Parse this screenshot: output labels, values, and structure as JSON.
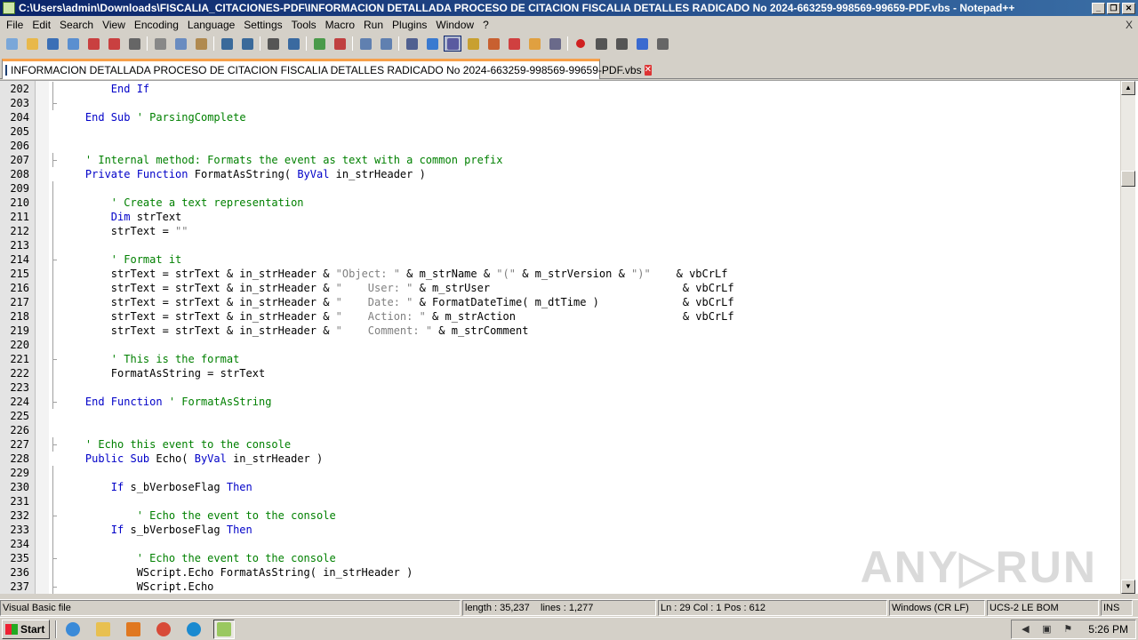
{
  "window": {
    "title": "C:\\Users\\admin\\Downloads\\FISCALIA_CITACIONES-PDF\\INFORMACION DETALLADA PROCESO DE CITACION FISCALIA DETALLES RADICADO No 2024-663259-998569-99659-PDF.vbs - Notepad++",
    "close_label": "X"
  },
  "menu": [
    "File",
    "Edit",
    "Search",
    "View",
    "Encoding",
    "Language",
    "Settings",
    "Tools",
    "Macro",
    "Run",
    "Plugins",
    "Window",
    "?"
  ],
  "toolbar_icons": [
    "new-file-icon",
    "open-file-icon",
    "save-icon",
    "save-all-icon",
    "close-icon",
    "close-all-icon",
    "print-icon",
    "sep",
    "cut-icon",
    "copy-icon",
    "paste-icon",
    "sep",
    "undo-icon",
    "redo-icon",
    "sep",
    "find-icon",
    "replace-icon",
    "sep",
    "zoom-in-icon",
    "zoom-out-icon",
    "sep",
    "sync-vertical-icon",
    "sync-horizontal-icon",
    "sep",
    "word-wrap-icon",
    "show-all-chars-icon",
    "indent-guide-icon",
    "udl-icon",
    "doc-map-icon",
    "function-list-icon",
    "folder-workspace-icon",
    "monitoring-icon",
    "sep",
    "record-macro-icon",
    "stop-macro-icon",
    "play-macro-icon",
    "run-macro-multiple-icon",
    "save-macro-icon"
  ],
  "tab": {
    "label": "INFORMACION DETALLADA PROCESO DE CITACION FISCALIA DETALLES RADICADO No 2024-663259-998569-99659-PDF.vbs",
    "close_glyph": "✕"
  },
  "code_lines": [
    {
      "n": "202",
      "fold": "line",
      "parts": [
        [
          "",
          "        "
        ],
        [
          "kw",
          "End If"
        ]
      ]
    },
    {
      "n": "203",
      "fold": "tick",
      "parts": []
    },
    {
      "n": "204",
      "fold": "none",
      "parts": [
        [
          "",
          "    "
        ],
        [
          "kw",
          "End Sub"
        ],
        [
          "",
          " "
        ],
        [
          "cm",
          "' ParsingComplete"
        ]
      ]
    },
    {
      "n": "205",
      "fold": "none",
      "parts": []
    },
    {
      "n": "206",
      "fold": "none",
      "parts": []
    },
    {
      "n": "207",
      "fold": "tick",
      "parts": [
        [
          "",
          "    "
        ],
        [
          "cm",
          "' Internal method: Formats the event as text with a common prefix"
        ]
      ]
    },
    {
      "n": "208",
      "fold": "none",
      "parts": [
        [
          "",
          "    "
        ],
        [
          "kw",
          "Private Function"
        ],
        [
          "",
          " FormatAsString( "
        ],
        [
          "kw",
          "ByVal"
        ],
        [
          "",
          " in_strHeader )"
        ]
      ]
    },
    {
      "n": "209",
      "fold": "line",
      "parts": []
    },
    {
      "n": "210",
      "fold": "line",
      "parts": [
        [
          "",
          "        "
        ],
        [
          "cm",
          "' Create a text representation"
        ]
      ]
    },
    {
      "n": "211",
      "fold": "line",
      "parts": [
        [
          "",
          "        "
        ],
        [
          "kw",
          "Dim"
        ],
        [
          "",
          " strText"
        ]
      ]
    },
    {
      "n": "212",
      "fold": "line",
      "parts": [
        [
          "",
          "        strText = "
        ],
        [
          "st",
          "\"\""
        ]
      ]
    },
    {
      "n": "213",
      "fold": "line",
      "parts": []
    },
    {
      "n": "214",
      "fold": "tick",
      "parts": [
        [
          "",
          "        "
        ],
        [
          "cm",
          "' Format it"
        ]
      ]
    },
    {
      "n": "215",
      "fold": "line",
      "parts": [
        [
          "",
          "        strText = strText & in_strHeader & "
        ],
        [
          "st",
          "\"Object: \""
        ],
        [
          "",
          " & m_strName & "
        ],
        [
          "st",
          "\"(\""
        ],
        [
          "",
          " & m_strVersion & "
        ],
        [
          "st",
          "\")\""
        ],
        [
          "",
          "    & vbCrLf"
        ]
      ]
    },
    {
      "n": "216",
      "fold": "line",
      "parts": [
        [
          "",
          "        strText = strText & in_strHeader & "
        ],
        [
          "st",
          "\"    User: \""
        ],
        [
          "",
          " & m_strUser                              & vbCrLf"
        ]
      ]
    },
    {
      "n": "217",
      "fold": "line",
      "parts": [
        [
          "",
          "        strText = strText & in_strHeader & "
        ],
        [
          "st",
          "\"    Date: \""
        ],
        [
          "",
          " & FormatDateTime( m_dtTime )             & vbCrLf"
        ]
      ]
    },
    {
      "n": "218",
      "fold": "line",
      "parts": [
        [
          "",
          "        strText = strText & in_strHeader & "
        ],
        [
          "st",
          "\"    Action: \""
        ],
        [
          "",
          " & m_strAction                          & vbCrLf"
        ]
      ]
    },
    {
      "n": "219",
      "fold": "line",
      "parts": [
        [
          "",
          "        strText = strText & in_strHeader & "
        ],
        [
          "st",
          "\"    Comment: \""
        ],
        [
          "",
          " & m_strComment"
        ]
      ]
    },
    {
      "n": "220",
      "fold": "line",
      "parts": []
    },
    {
      "n": "221",
      "fold": "tick",
      "parts": [
        [
          "",
          "        "
        ],
        [
          "cm",
          "' This is the format"
        ]
      ]
    },
    {
      "n": "222",
      "fold": "line",
      "parts": [
        [
          "",
          "        FormatAsString = strText"
        ]
      ]
    },
    {
      "n": "223",
      "fold": "line",
      "parts": []
    },
    {
      "n": "224",
      "fold": "tick",
      "parts": [
        [
          "",
          "    "
        ],
        [
          "kw",
          "End Function"
        ],
        [
          "",
          " "
        ],
        [
          "cm",
          "' FormatAsString"
        ]
      ]
    },
    {
      "n": "225",
      "fold": "none",
      "parts": []
    },
    {
      "n": "226",
      "fold": "none",
      "parts": []
    },
    {
      "n": "227",
      "fold": "tick",
      "parts": [
        [
          "",
          "    "
        ],
        [
          "cm",
          "' Echo this event to the console"
        ]
      ]
    },
    {
      "n": "228",
      "fold": "none",
      "parts": [
        [
          "",
          "    "
        ],
        [
          "kw",
          "Public Sub"
        ],
        [
          "",
          " Echo( "
        ],
        [
          "kw",
          "ByVal"
        ],
        [
          "",
          " in_strHeader )"
        ]
      ]
    },
    {
      "n": "229",
      "fold": "line",
      "parts": []
    },
    {
      "n": "230",
      "fold": "line",
      "parts": [
        [
          "",
          "        "
        ],
        [
          "kw",
          "If"
        ],
        [
          "",
          " s_bVerboseFlag "
        ],
        [
          "kw",
          "Then"
        ]
      ]
    },
    {
      "n": "231",
      "fold": "line",
      "parts": []
    },
    {
      "n": "232",
      "fold": "tick",
      "parts": [
        [
          "",
          "            "
        ],
        [
          "cm",
          "' Echo the event to the console"
        ]
      ]
    },
    {
      "n": "233",
      "fold": "line",
      "parts": [
        [
          "",
          "        "
        ],
        [
          "kw",
          "If"
        ],
        [
          "",
          " s_bVerboseFlag "
        ],
        [
          "kw",
          "Then"
        ]
      ]
    },
    {
      "n": "234",
      "fold": "line",
      "parts": []
    },
    {
      "n": "235",
      "fold": "tick",
      "parts": [
        [
          "",
          "            "
        ],
        [
          "cm",
          "' Echo the event to the console"
        ]
      ]
    },
    {
      "n": "236",
      "fold": "line",
      "parts": [
        [
          "",
          "            WScript.Echo FormatAsString( in_strHeader )"
        ]
      ]
    },
    {
      "n": "237",
      "fold": "tick",
      "parts": [
        [
          "",
          "            WScript.Echo"
        ]
      ]
    }
  ],
  "watermark": "ANY▷RUN",
  "status": {
    "file_type": "Visual Basic file",
    "length": "length : 35,237",
    "lines": "lines : 1,277",
    "position": "Ln : 29    Col : 1    Pos : 612",
    "eol": "Windows (CR LF)",
    "encoding": "UCS-2 LE BOM",
    "mode": "INS"
  },
  "taskbar": {
    "start_label": "Start",
    "apps": [
      "ie-icon",
      "explorer-icon",
      "media-player-icon",
      "chrome-icon",
      "edge-icon",
      "notepadpp-icon"
    ],
    "tray_icons": [
      "volume-icon",
      "network-icon",
      "flag-icon"
    ],
    "clock": "5:26 PM"
  }
}
